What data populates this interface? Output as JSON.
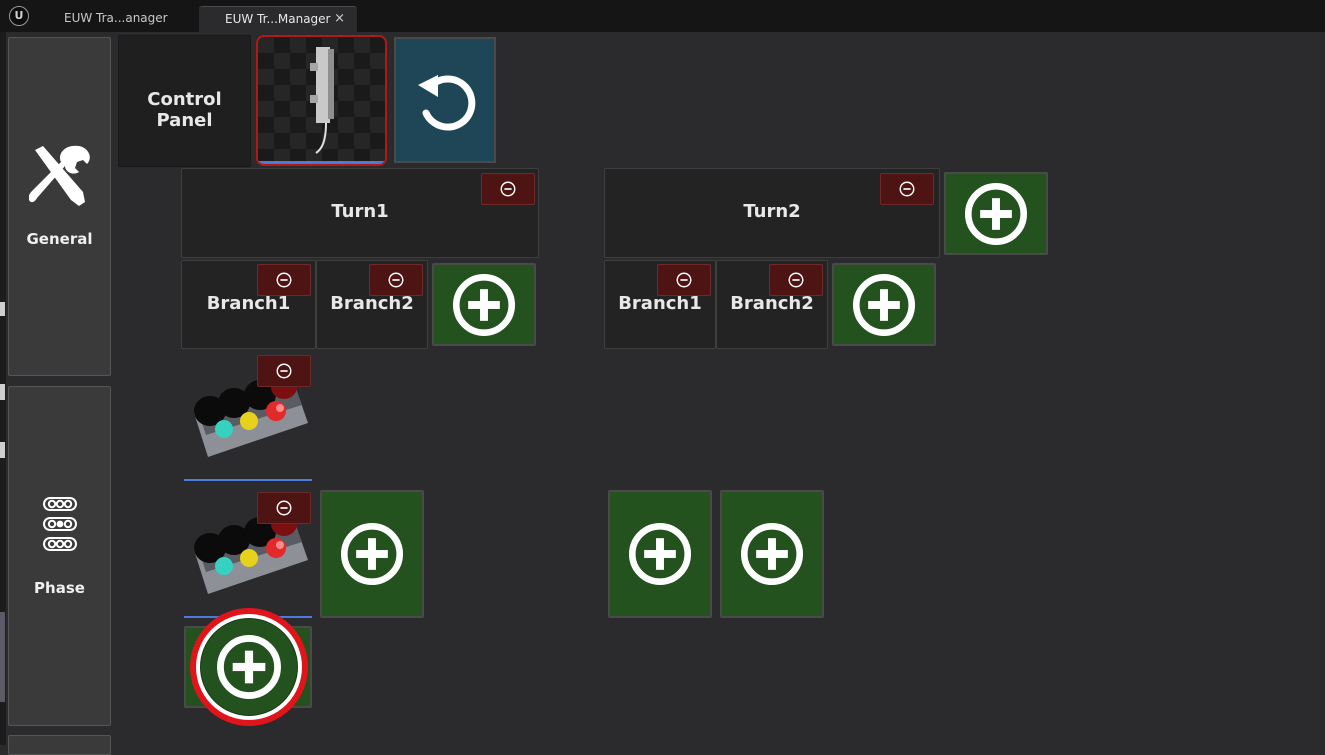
{
  "window": {
    "tabs": [
      {
        "label": "EUW Tra...anager"
      },
      {
        "label": "EUW Tr...Manager",
        "close": "×"
      }
    ],
    "logo": "U"
  },
  "sidebar": {
    "general_label": "General",
    "general_icon": "tools-icon",
    "phase_label": "Phase",
    "phase_icon": "traffic-light-icon"
  },
  "header": {
    "control_panel_label": "Control Panel",
    "refresh_icon": "refresh-icon",
    "thumbnail": "signal-pole-thumbnail"
  },
  "turns": [
    {
      "label": "Turn1",
      "branches": [
        {
          "label": "Branch1"
        },
        {
          "label": "Branch2"
        }
      ]
    },
    {
      "label": "Turn2",
      "branches": [
        {
          "label": "Branch1"
        },
        {
          "label": "Branch2"
        }
      ]
    }
  ],
  "colors": {
    "add": "#23521f",
    "remove": "#4e1414",
    "refresh": "#1f4657",
    "highlight": "#e0141b"
  }
}
